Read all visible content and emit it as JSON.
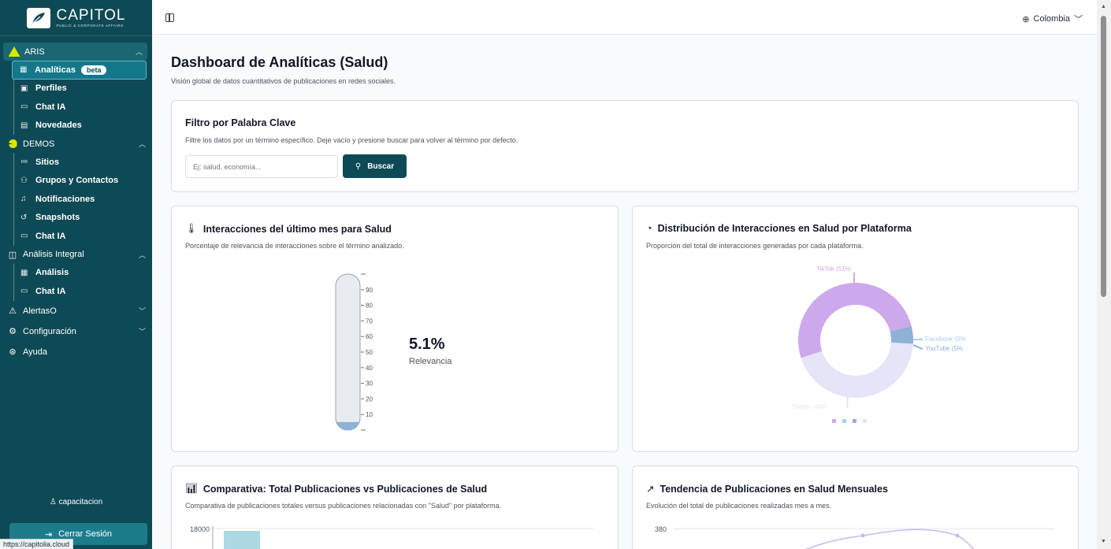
{
  "brand": {
    "name": "CAPITOL",
    "tagline": "PUBLIC & CORPORATE AFFAIRS"
  },
  "sidebar": {
    "sections": [
      {
        "label": "ARIS",
        "items": [
          {
            "label": "Analíticas",
            "badge": "beta"
          },
          {
            "label": "Perfiles"
          },
          {
            "label": "Chat IA"
          },
          {
            "label": "Novedades"
          }
        ]
      },
      {
        "label": "DEMOS",
        "items": [
          {
            "label": "Sitios"
          },
          {
            "label": "Grupos y Contactos"
          },
          {
            "label": "Notificaciones"
          },
          {
            "label": "Snapshots"
          },
          {
            "label": "Chat IA"
          }
        ]
      },
      {
        "label": "Análisis Integral",
        "items": [
          {
            "label": "Análisis"
          },
          {
            "label": "Chat IA"
          }
        ]
      },
      {
        "label": "AlertasO"
      },
      {
        "label": "Configuración"
      },
      {
        "label": "Ayuda"
      }
    ],
    "user": "capacitacion",
    "logout_label": "Cerrar Sesión",
    "status_url": "https://capitolia.cloud"
  },
  "topbar": {
    "country": "Colombia"
  },
  "page": {
    "title": "Dashboard de Analíticas (Salud)",
    "subtitle": "Visión global de datos cuantitativos de publicaciones en redes sociales."
  },
  "filter": {
    "title": "Filtro por Palabra Clave",
    "subtitle": "Filtre los datos por un término específico. Deje vacío y presione buscar para volver al término por defecto.",
    "placeholder": "Ej: salud, economía...",
    "button": "Buscar"
  },
  "cards": {
    "interactions": {
      "title": "Interacciones del último mes para Salud",
      "subtitle": "Porcentaje de relevancia de interacciones sobre el término analizado.",
      "value": "5.1%",
      "value_label": "Relevancia"
    },
    "distribution": {
      "title": "Distribución de Interacciones en Salud por Plataforma",
      "subtitle": "Proporción del total de interacciones generadas por cada plataforma."
    },
    "comparison": {
      "title": "Comparativa: Total Publicaciones vs Publicaciones de Salud",
      "subtitle": "Comparativa de publicaciones totales versus publicaciones relacionadas con \"Salud\" por plataforma."
    },
    "trend": {
      "title": "Tendencia de Publicaciones en Salud Mensuales",
      "subtitle": "Evolución del total de publicaciones realizadas mes a mes."
    }
  },
  "chart_data": [
    {
      "type": "gauge",
      "ticks": [
        "90",
        "80",
        "70",
        "60",
        "50",
        "40",
        "30",
        "20",
        "10"
      ],
      "value": 5.1,
      "range": [
        0,
        100
      ]
    },
    {
      "type": "pie",
      "categories": [
        "TikTok",
        "Facebook",
        "YouTube",
        "Twitter"
      ],
      "labels": [
        "TikTok (51%",
        "Facebook (0%",
        "YouTube (5%",
        "Twitter (44%"
      ],
      "values": [
        51,
        0,
        5,
        44
      ],
      "colors": [
        "#cda9ec",
        "#a9d3e6",
        "#8fb1d6",
        "#e6e5f8"
      ]
    },
    {
      "type": "bar",
      "ytick_top": "18000",
      "bar_color": "#aad8e3"
    },
    {
      "type": "line",
      "ytick_top": "380",
      "line_color": "#c9b8f0"
    }
  ]
}
